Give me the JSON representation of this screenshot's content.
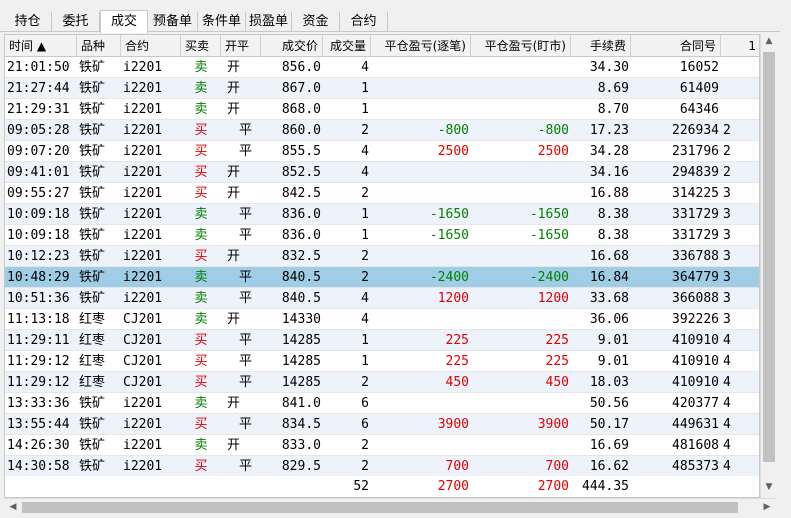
{
  "tabs": [
    {
      "label": "持仓"
    },
    {
      "label": "委托"
    },
    {
      "label": "成交",
      "active": true
    },
    {
      "label": "预备单"
    },
    {
      "label": "条件单"
    },
    {
      "label": "损盈单"
    },
    {
      "label": "资金"
    },
    {
      "label": "合约"
    }
  ],
  "columns": [
    {
      "key": "time",
      "label": "时间 ▲"
    },
    {
      "key": "product",
      "label": "品种"
    },
    {
      "key": "contract",
      "label": "合约"
    },
    {
      "key": "side",
      "label": "买卖"
    },
    {
      "key": "offset",
      "label": "开平"
    },
    {
      "key": "price",
      "label": "成交价"
    },
    {
      "key": "qty",
      "label": "成交量"
    },
    {
      "key": "pnl_close",
      "label": "平仓盈亏(逐笔)"
    },
    {
      "key": "pnl_mtm",
      "label": "平仓盈亏(盯市)"
    },
    {
      "key": "fee",
      "label": "手续费"
    },
    {
      "key": "order_id",
      "label": "合同号"
    },
    {
      "key": "extra",
      "label": "1"
    }
  ],
  "rows": [
    {
      "time": "21:01:50",
      "product": "铁矿",
      "contract": "i2201",
      "side": "卖",
      "offset": "开",
      "price": "856.0",
      "qty": "4",
      "pnl_close": "",
      "pnl_mtm": "",
      "fee": "34.30",
      "order_id": "16052",
      "extra": ""
    },
    {
      "time": "21:27:44",
      "product": "铁矿",
      "contract": "i2201",
      "side": "卖",
      "offset": "开",
      "price": "867.0",
      "qty": "1",
      "pnl_close": "",
      "pnl_mtm": "",
      "fee": "8.69",
      "order_id": "61409",
      "extra": ""
    },
    {
      "time": "21:29:31",
      "product": "铁矿",
      "contract": "i2201",
      "side": "卖",
      "offset": "开",
      "price": "868.0",
      "qty": "1",
      "pnl_close": "",
      "pnl_mtm": "",
      "fee": "8.70",
      "order_id": "64346",
      "extra": ""
    },
    {
      "time": "09:05:28",
      "product": "铁矿",
      "contract": "i2201",
      "side": "买",
      "offset": "平",
      "price": "860.0",
      "qty": "2",
      "pnl_close": "-800",
      "pnl_mtm": "-800",
      "fee": "17.23",
      "order_id": "226934",
      "extra": "2"
    },
    {
      "time": "09:07:20",
      "product": "铁矿",
      "contract": "i2201",
      "side": "买",
      "offset": "平",
      "price": "855.5",
      "qty": "4",
      "pnl_close": "2500",
      "pnl_mtm": "2500",
      "fee": "34.28",
      "order_id": "231796",
      "extra": "2"
    },
    {
      "time": "09:41:01",
      "product": "铁矿",
      "contract": "i2201",
      "side": "买",
      "offset": "开",
      "price": "852.5",
      "qty": "4",
      "pnl_close": "",
      "pnl_mtm": "",
      "fee": "34.16",
      "order_id": "294839",
      "extra": "2"
    },
    {
      "time": "09:55:27",
      "product": "铁矿",
      "contract": "i2201",
      "side": "买",
      "offset": "开",
      "price": "842.5",
      "qty": "2",
      "pnl_close": "",
      "pnl_mtm": "",
      "fee": "16.88",
      "order_id": "314225",
      "extra": "3"
    },
    {
      "time": "10:09:18",
      "product": "铁矿",
      "contract": "i2201",
      "side": "卖",
      "offset": "平",
      "price": "836.0",
      "qty": "1",
      "pnl_close": "-1650",
      "pnl_mtm": "-1650",
      "fee": "8.38",
      "order_id": "331729",
      "extra": "3"
    },
    {
      "time": "10:09:18",
      "product": "铁矿",
      "contract": "i2201",
      "side": "卖",
      "offset": "平",
      "price": "836.0",
      "qty": "1",
      "pnl_close": "-1650",
      "pnl_mtm": "-1650",
      "fee": "8.38",
      "order_id": "331729",
      "extra": "3"
    },
    {
      "time": "10:12:23",
      "product": "铁矿",
      "contract": "i2201",
      "side": "买",
      "offset": "开",
      "price": "832.5",
      "qty": "2",
      "pnl_close": "",
      "pnl_mtm": "",
      "fee": "16.68",
      "order_id": "336788",
      "extra": "3"
    },
    {
      "time": "10:48:29",
      "product": "铁矿",
      "contract": "i2201",
      "side": "卖",
      "offset": "平",
      "price": "840.5",
      "qty": "2",
      "pnl_close": "-2400",
      "pnl_mtm": "-2400",
      "fee": "16.84",
      "order_id": "364779",
      "extra": "3",
      "selected": true
    },
    {
      "time": "10:51:36",
      "product": "铁矿",
      "contract": "i2201",
      "side": "卖",
      "offset": "平",
      "price": "840.5",
      "qty": "4",
      "pnl_close": "1200",
      "pnl_mtm": "1200",
      "fee": "33.68",
      "order_id": "366088",
      "extra": "3"
    },
    {
      "time": "11:13:18",
      "product": "红枣",
      "contract": "CJ201",
      "side": "卖",
      "offset": "开",
      "price": "14330",
      "qty": "4",
      "pnl_close": "",
      "pnl_mtm": "",
      "fee": "36.06",
      "order_id": "392226",
      "extra": "3"
    },
    {
      "time": "11:29:11",
      "product": "红枣",
      "contract": "CJ201",
      "side": "买",
      "offset": "平",
      "price": "14285",
      "qty": "1",
      "pnl_close": "225",
      "pnl_mtm": "225",
      "fee": "9.01",
      "order_id": "410910",
      "extra": "4"
    },
    {
      "time": "11:29:12",
      "product": "红枣",
      "contract": "CJ201",
      "side": "买",
      "offset": "平",
      "price": "14285",
      "qty": "1",
      "pnl_close": "225",
      "pnl_mtm": "225",
      "fee": "9.01",
      "order_id": "410910",
      "extra": "4"
    },
    {
      "time": "11:29:12",
      "product": "红枣",
      "contract": "CJ201",
      "side": "买",
      "offset": "平",
      "price": "14285",
      "qty": "2",
      "pnl_close": "450",
      "pnl_mtm": "450",
      "fee": "18.03",
      "order_id": "410910",
      "extra": "4"
    },
    {
      "time": "13:33:36",
      "product": "铁矿",
      "contract": "i2201",
      "side": "卖",
      "offset": "开",
      "price": "841.0",
      "qty": "6",
      "pnl_close": "",
      "pnl_mtm": "",
      "fee": "50.56",
      "order_id": "420377",
      "extra": "4"
    },
    {
      "time": "13:55:44",
      "product": "铁矿",
      "contract": "i2201",
      "side": "买",
      "offset": "平",
      "price": "834.5",
      "qty": "6",
      "pnl_close": "3900",
      "pnl_mtm": "3900",
      "fee": "50.17",
      "order_id": "449631",
      "extra": "4"
    },
    {
      "time": "14:26:30",
      "product": "铁矿",
      "contract": "i2201",
      "side": "卖",
      "offset": "开",
      "price": "833.0",
      "qty": "2",
      "pnl_close": "",
      "pnl_mtm": "",
      "fee": "16.69",
      "order_id": "481608",
      "extra": "4"
    },
    {
      "time": "14:30:58",
      "product": "铁矿",
      "contract": "i2201",
      "side": "买",
      "offset": "平",
      "price": "829.5",
      "qty": "2",
      "pnl_close": "700",
      "pnl_mtm": "700",
      "fee": "16.62",
      "order_id": "485373",
      "extra": "4"
    }
  ],
  "totals": {
    "qty": "52",
    "pnl_close": "2700",
    "pnl_mtm": "2700",
    "fee": "444.35"
  },
  "colors": {
    "profit": "#e00000",
    "loss": "#008000",
    "buy": "#e00000",
    "sell": "#008000",
    "selected": "#9fcde6"
  },
  "icons": {
    "scroll_up": "▲",
    "scroll_down": "▼",
    "scroll_left": "◀",
    "scroll_right": "▶"
  }
}
